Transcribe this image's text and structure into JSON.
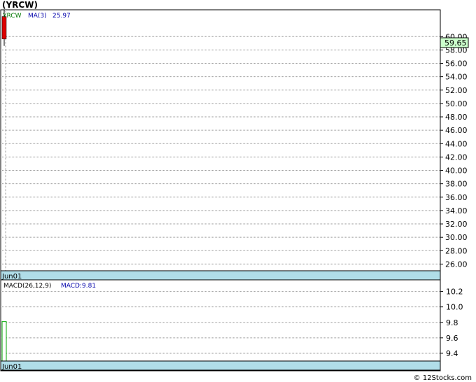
{
  "header": {
    "title": "(YRCW)"
  },
  "footer": {
    "credit": "© 12Stocks.com"
  },
  "chart_data": [
    {
      "type": "candlestick",
      "symbol_label": "YRCW",
      "ma_label": "MA(3)",
      "ma_value": "25.97",
      "last_price_label": "59.65",
      "x_label": "Jun01",
      "ylim": [
        25,
        64
      ],
      "yticks": [
        {
          "v": 60,
          "label": "60.00"
        },
        {
          "v": 58,
          "label": "58.00"
        },
        {
          "v": 56,
          "label": "56.00"
        },
        {
          "v": 54,
          "label": "54.00"
        },
        {
          "v": 52,
          "label": "52.00"
        },
        {
          "v": 50,
          "label": "50.00"
        },
        {
          "v": 48,
          "label": "48.00"
        },
        {
          "v": 46,
          "label": "46.00"
        },
        {
          "v": 44,
          "label": "44.00"
        },
        {
          "v": 42,
          "label": "42.00"
        },
        {
          "v": 40,
          "label": "40.00"
        },
        {
          "v": 38,
          "label": "38.00"
        },
        {
          "v": 36,
          "label": "36.00"
        },
        {
          "v": 34,
          "label": "34.00"
        },
        {
          "v": 32,
          "label": "32.00"
        },
        {
          "v": 30,
          "label": "30.00"
        },
        {
          "v": 28,
          "label": "28.00"
        },
        {
          "v": 26,
          "label": "26.00"
        }
      ],
      "candles": [
        {
          "open": 63.0,
          "high": 64.0,
          "low": 58.6,
          "close": 59.65
        }
      ],
      "colors": {
        "candle_down": "#dd0000",
        "last_price_bg": "#ccffcc",
        "date_bar": "#b0dde8"
      },
      "grid": true
    },
    {
      "type": "bar",
      "indicator_label": "MACD(26,12,9)",
      "value_label": "MACD:9.81",
      "x_label": "Jun01",
      "ylim": [
        9.3,
        10.35
      ],
      "yticks": [
        {
          "v": 10.2,
          "label": "10.2"
        },
        {
          "v": 10.0,
          "label": "10.0"
        },
        {
          "v": 9.8,
          "label": "9.8"
        },
        {
          "v": 9.6,
          "label": "9.6"
        },
        {
          "v": 9.4,
          "label": "9.4"
        }
      ],
      "values": [
        9.81
      ],
      "colors": {
        "bar": "#00aa00",
        "date_bar": "#b0dde8"
      },
      "grid": true
    }
  ]
}
